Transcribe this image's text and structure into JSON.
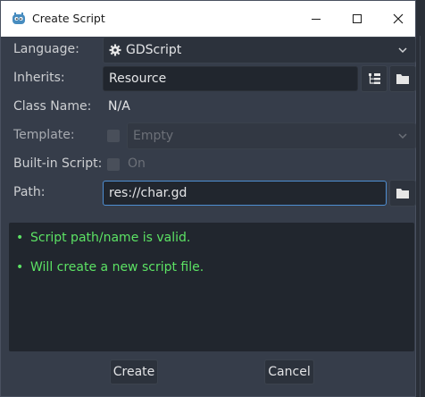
{
  "window": {
    "title": "Create Script",
    "controls": {
      "minimize": "—",
      "maximize": "☐",
      "close": "✕"
    }
  },
  "form": {
    "language": {
      "label": "Language:",
      "value": "GDScript"
    },
    "inherits": {
      "label": "Inherits:",
      "value": "Resource"
    },
    "class_name": {
      "label": "Class Name:",
      "value": "N/A"
    },
    "template": {
      "label": "Template:",
      "value": "Empty",
      "checked": false
    },
    "builtin": {
      "label": "Built-in Script:",
      "value": "On",
      "checked": false
    },
    "path": {
      "label": "Path:",
      "value": "res://char.gd"
    }
  },
  "messages": [
    "Script path/name is valid.",
    "Will create a new script file."
  ],
  "buttons": {
    "create": "Create",
    "cancel": "Cancel"
  },
  "colors": {
    "window_bg": "#363d4a",
    "field_bg": "#21262e",
    "success_text": "#5ce264",
    "focus_border": "#4e8ed2"
  }
}
